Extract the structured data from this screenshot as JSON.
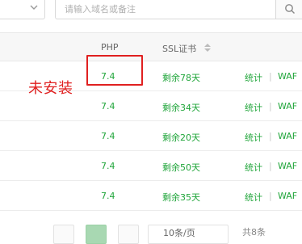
{
  "toolbar": {
    "search_placeholder": "请输入域名或备注"
  },
  "table": {
    "columns": {
      "php": "PHP",
      "ssl": "SSL证书"
    },
    "rows": [
      {
        "php": "7.4",
        "ssl": "剩余78天",
        "stat": "统计",
        "sep": "|",
        "waf": "WAF"
      },
      {
        "php": "7.4",
        "ssl": "剩余34天",
        "stat": "统计",
        "sep": "|",
        "waf": "WAF"
      },
      {
        "php": "7.4",
        "ssl": "剩余20天",
        "stat": "统计",
        "sep": "|",
        "waf": "WAF"
      },
      {
        "php": "7.4",
        "ssl": "剩余50天",
        "stat": "统计",
        "sep": "|",
        "waf": "WAF"
      },
      {
        "php": "7.4",
        "ssl": "剩余35天",
        "stat": "统计",
        "sep": "|",
        "waf": "WAF"
      }
    ]
  },
  "annotation": {
    "text": "未安装",
    "color": "#e02020"
  },
  "pagination": {
    "page_size": "10条/页",
    "total": "共8条"
  },
  "colors": {
    "accent": "#20a53a",
    "annotation_red": "#e02020"
  }
}
